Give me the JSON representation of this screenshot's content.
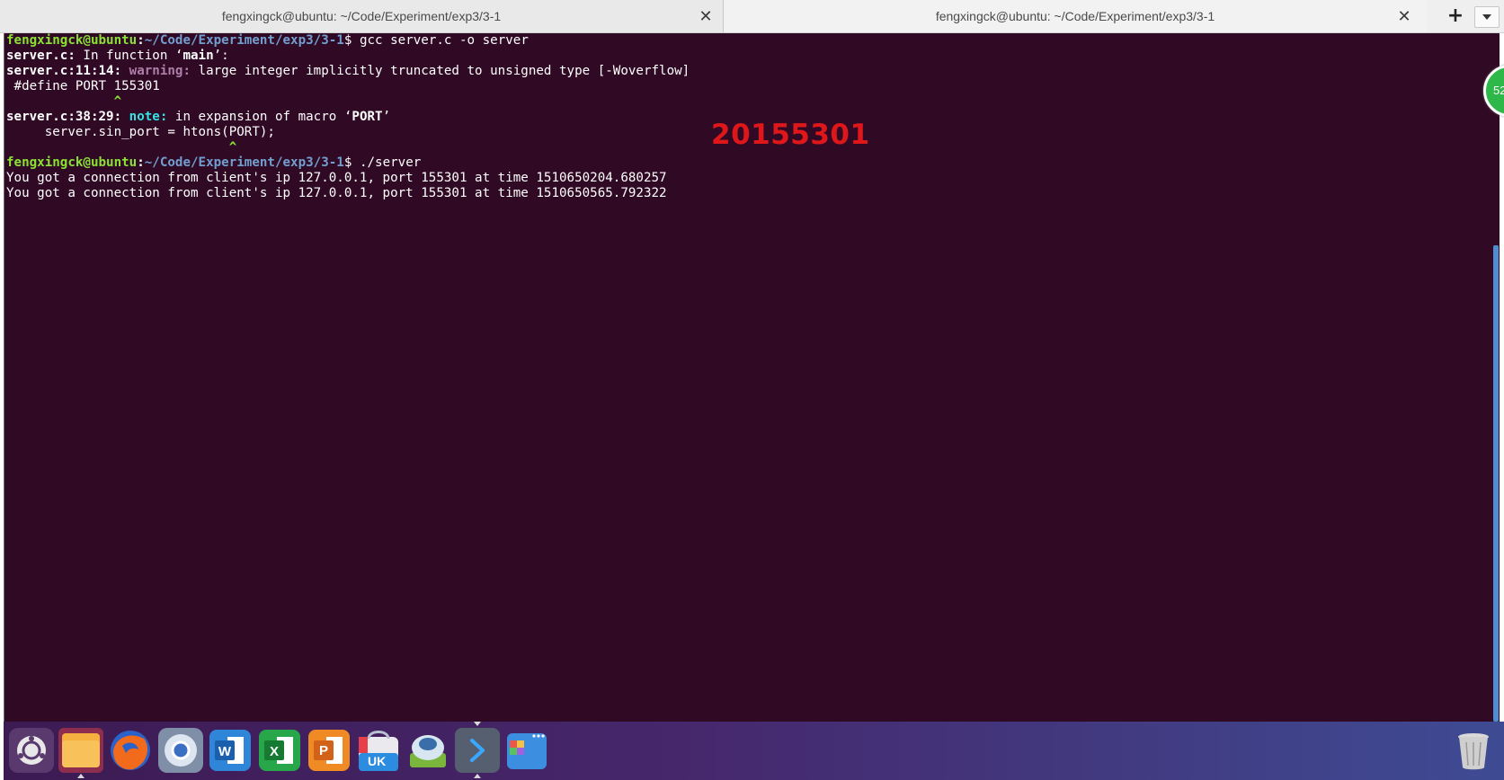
{
  "tabs": [
    {
      "title": "fengxingck@ubuntu: ~/Code/Experiment/exp3/3-1",
      "close": "✕"
    },
    {
      "title": "fengxingck@ubuntu: ~/Code/Experiment/exp3/3-1",
      "close": "✕"
    }
  ],
  "tabbar": {
    "add": "+"
  },
  "terminal": {
    "user": "fengxingck@ubuntu",
    "path1": "~/Code/Experiment/exp3/3-1",
    "cmd1": "$ gcc server.c -o server",
    "l2_file": "server.c:",
    "l2_in": " In function ",
    "l2_q1": "‘",
    "l2_main": "main",
    "l2_q2": "’:",
    "l3_loc": "server.c:11:14:",
    "l3_warn": "warning:",
    "l3_msg": " large integer implicitly truncated to unsigned type [-Woverflow]",
    "l4": " #define PORT 155301",
    "l5_caret": "              ^",
    "l6_loc": "server.c:38:29:",
    "l6_note": "note:",
    "l6_msg": " in expansion of macro ",
    "l6_q1": "‘",
    "l6_port": "PORT",
    "l6_q2": "’",
    "l7": "     server.sin_port = htons(PORT);",
    "l8_caret": "                             ^",
    "path2": "~/Code/Experiment/exp3/3-1",
    "cmd2": "$ ./server",
    "out1": "You got a connection from client's ip 127.0.0.1, port 155301 at time 1510650204.680257",
    "out2": "You got a connection from client's ip 127.0.0.1, port 155301 at time 1510650565.792322",
    "stamp": "20155301"
  },
  "badge": {
    "text": "52"
  },
  "dock": {
    "items": [
      "ubuntu-icon",
      "files-icon",
      "firefox-icon",
      "chromium-icon",
      "wps-writer-icon",
      "wps-spreadsheet-icon",
      "wps-presentation-icon",
      "software-center-icon",
      "mail-icon",
      "terminal-icon",
      "workspace-icon"
    ],
    "ppt_letter": "P",
    "uk_text": "UK"
  }
}
